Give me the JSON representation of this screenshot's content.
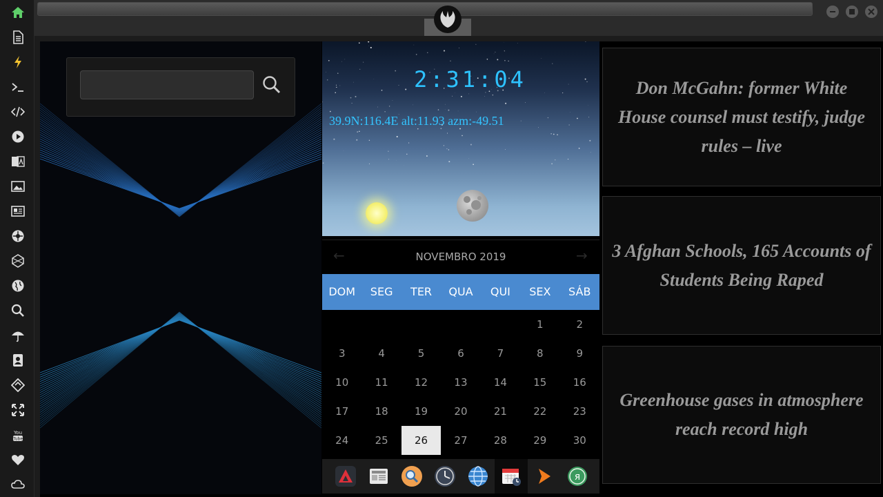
{
  "sidebar": {
    "items": [
      {
        "icon": "home-icon",
        "color": "#5fcf6a"
      },
      {
        "icon": "document-icon"
      },
      {
        "icon": "lightning-icon",
        "color": "#f2c230"
      },
      {
        "icon": "terminal-icon"
      },
      {
        "icon": "code-icon"
      },
      {
        "icon": "play-icon"
      },
      {
        "icon": "translate-icon"
      },
      {
        "icon": "image-icon"
      },
      {
        "icon": "newspaper-icon"
      },
      {
        "icon": "rebel-icon"
      },
      {
        "icon": "empire-icon"
      },
      {
        "icon": "globe-icon"
      },
      {
        "icon": "search-icon"
      },
      {
        "icon": "umbrella-icon"
      },
      {
        "icon": "contacts-icon"
      },
      {
        "icon": "tag-icon"
      },
      {
        "icon": "expand-icon"
      },
      {
        "icon": "youtube-icon"
      },
      {
        "icon": "heart-icon"
      },
      {
        "icon": "cloud-icon"
      }
    ]
  },
  "search": {
    "value": "",
    "placeholder": ""
  },
  "clock": {
    "time": "2:31:04"
  },
  "sky": {
    "coords": "39.9N:116.4E  alt:11.93 azm:-49.51"
  },
  "calendar": {
    "month_label": "NOVEMBRO 2019",
    "weekdays": [
      "DOM",
      "SEG",
      "TER",
      "QUA",
      "QUI",
      "SEX",
      "SÁB"
    ],
    "weeks": [
      [
        "",
        "",
        "",
        "",
        "",
        "1",
        "2"
      ],
      [
        "3",
        "4",
        "5",
        "6",
        "7",
        "8",
        "9"
      ],
      [
        "10",
        "11",
        "12",
        "13",
        "14",
        "15",
        "16"
      ],
      [
        "17",
        "18",
        "19",
        "20",
        "21",
        "22",
        "23"
      ],
      [
        "24",
        "25",
        "26",
        "27",
        "28",
        "29",
        "30"
      ]
    ],
    "today": "26",
    "prev_arrow": "←",
    "next_arrow": "→"
  },
  "dock": {
    "items": [
      {
        "icon": "red-triangle-app-icon"
      },
      {
        "icon": "news-app-icon"
      },
      {
        "icon": "search-app-icon"
      },
      {
        "icon": "clock-app-icon"
      },
      {
        "icon": "globe-app-icon"
      },
      {
        "icon": "calendar-app-icon",
        "active": true
      },
      {
        "icon": "orange-arrow-app-icon"
      },
      {
        "icon": "yandex-app-icon"
      }
    ]
  },
  "news": [
    {
      "headline": "Don McGahn: former White House counsel must testify, judge rules – live"
    },
    {
      "headline": "3 Afghan Schools, 165 Accounts of Students Being Raped"
    },
    {
      "headline": "Greenhouse gases in atmosphere reach record high"
    }
  ],
  "colors": {
    "accent": "#4a8ad0",
    "clock": "#2ec2ff",
    "news_text": "#9a9a9a"
  }
}
